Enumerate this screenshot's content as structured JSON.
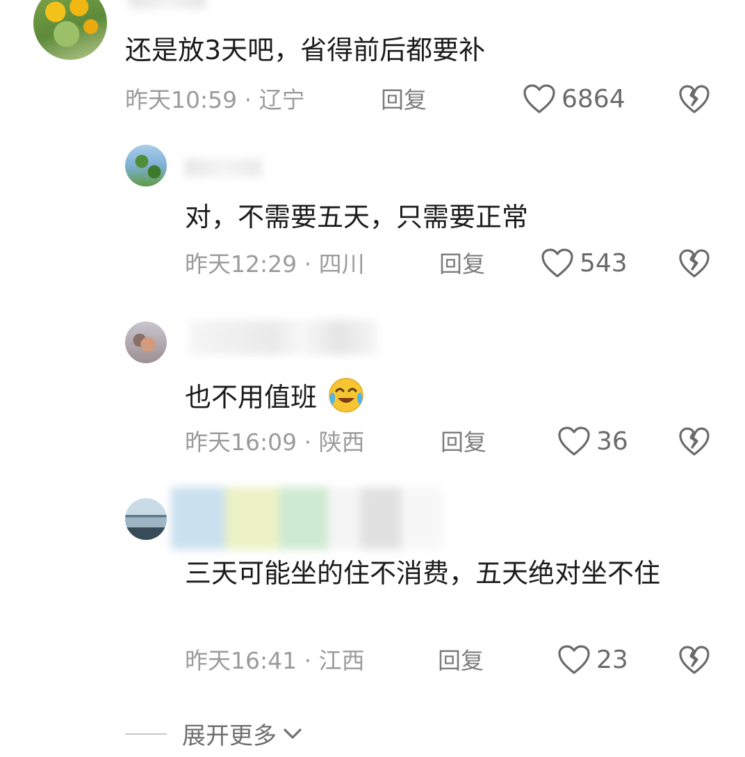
{
  "comments": [
    {
      "text": "还是放3天吧，省得前后都要补",
      "meta": "昨天10:59 · 辽宁",
      "reply": "回复",
      "likes": "6864"
    },
    {
      "text": "对，不需要五天，只需要正常",
      "meta": "昨天12:29 · 四川",
      "reply": "回复",
      "likes": "543"
    },
    {
      "text": "也不用值班",
      "meta": "昨天16:09 · 陕西",
      "reply": "回复",
      "likes": "36"
    },
    {
      "text": "三天可能坐的住不消费，五天绝对坐不住",
      "meta": "昨天16:41 · 江西",
      "reply": "回复",
      "likes": "23"
    }
  ],
  "expand_more": "展开更多",
  "icons": {
    "like": "heart-outline-icon",
    "dislike": "broken-heart-icon",
    "expand": "chevron-down-icon",
    "emoji": "crying-laughing-emoji"
  },
  "colors": {
    "text": "#1b1b1b",
    "meta": "#9b9b9b",
    "icon": "#6a6a6a"
  }
}
